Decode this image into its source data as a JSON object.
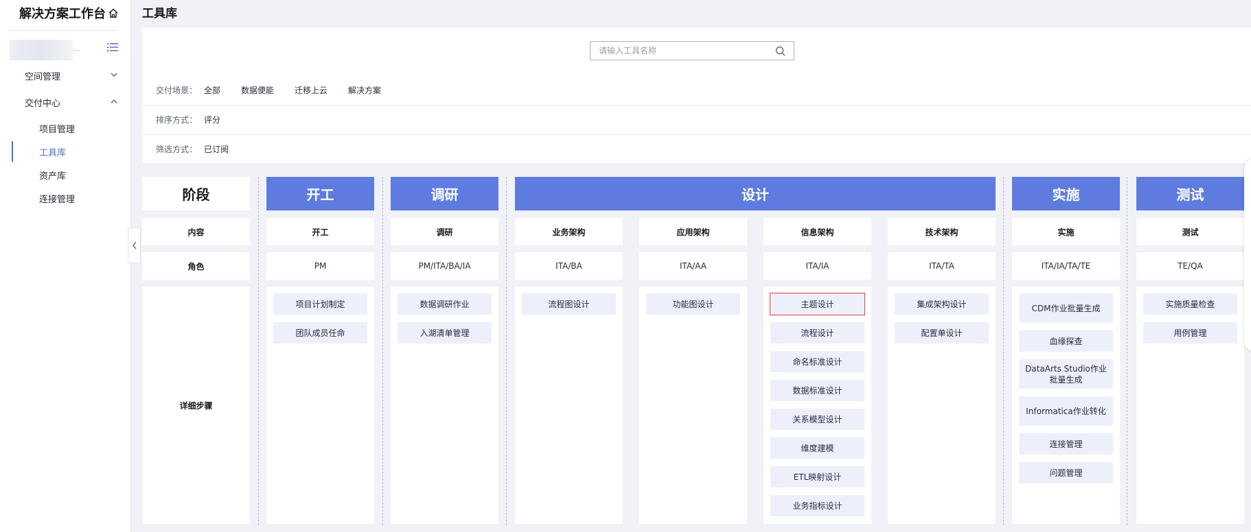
{
  "sidebar": {
    "brand": "解决方案工作台",
    "groups": [
      {
        "label": "空间管理"
      },
      {
        "label": "交付中心"
      }
    ],
    "sub_items": [
      "项目管理",
      "工具库",
      "资产库",
      "连接管理"
    ]
  },
  "page": {
    "title": "工具库"
  },
  "search": {
    "placeholder": "请输入工具名称",
    "value": ""
  },
  "filters": {
    "scene_label": "交付场景：",
    "scene_options": [
      "全部",
      "数据便能",
      "迁移上云",
      "解决方案"
    ],
    "sort_label": "排序方式：",
    "sort_value": "评分",
    "filter_label": "筛选方式：",
    "filter_value": "已订阅"
  },
  "matrix": {
    "stage_header": "阶段",
    "content_label": "内容",
    "role_label": "角色",
    "steps_label": "详细步骤",
    "phases": [
      {
        "name": "开工",
        "columns": [
          {
            "content": "开工",
            "role": "PM",
            "tools": [
              "项目计划制定",
              "团队成员任命"
            ]
          }
        ]
      },
      {
        "name": "调研",
        "columns": [
          {
            "content": "调研",
            "role": "PM/ITA/BA/IA",
            "tools": [
              "数据调研作业",
              "入湖清单管理"
            ]
          }
        ]
      },
      {
        "name": "设计",
        "columns": [
          {
            "content": "业务架构",
            "role": "ITA/BA",
            "tools": [
              "流程图设计"
            ]
          },
          {
            "content": "应用架构",
            "role": "ITA/AA",
            "tools": [
              "功能图设计"
            ]
          },
          {
            "content": "信息架构",
            "role": "ITA/IA",
            "tools": [
              "主题设计",
              "流程设计",
              "命名标准设计",
              "数据标准设计",
              "关系模型设计",
              "维度建模",
              "ETL映射设计",
              "业务指标设计"
            ]
          },
          {
            "content": "技术架构",
            "role": "ITA/TA",
            "tools": [
              "集成架构设计",
              "配置单设计"
            ]
          }
        ]
      },
      {
        "name": "实施",
        "columns": [
          {
            "content": "实施",
            "role": "ITA/IA/TA/TE",
            "tools": [
              "CDM作业批量生成",
              "血缘探查",
              "DataArts Studio作业批量生成",
              "Informatica作业转化",
              "连接管理",
              "问题管理"
            ]
          }
        ]
      },
      {
        "name": "测试",
        "columns": [
          {
            "content": "测试",
            "role": "TE/QA",
            "tools": [
              "实施质量检查",
              "用例管理"
            ]
          }
        ]
      }
    ]
  },
  "colors": {
    "accent": "#5e7ce0",
    "active_link": "#526ecc",
    "tool_bg": "#edf0fb",
    "selection": "#e03b3b"
  },
  "icons": [
    "home-icon",
    "list-icon",
    "chevron-down-icon",
    "chevron-up-icon",
    "chevron-left-icon",
    "search-icon"
  ]
}
